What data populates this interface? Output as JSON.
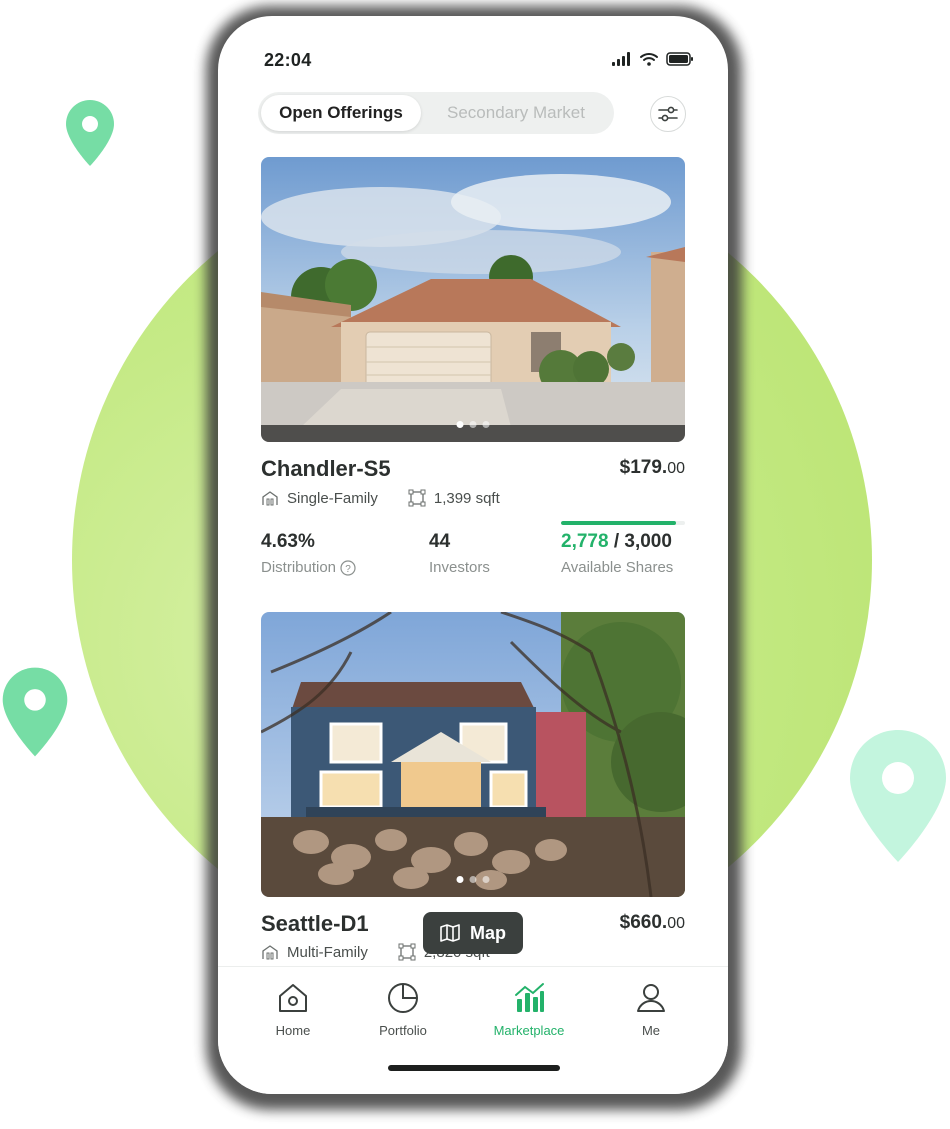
{
  "status_bar": {
    "time": "22:04"
  },
  "segmented": {
    "active": "Open Offerings",
    "inactive": "Secondary Market"
  },
  "listings": [
    {
      "name": "Chandler-S5",
      "price_whole": "$179.",
      "price_cents": "00",
      "type": "Single-Family",
      "area": "1,399 sqft",
      "distribution": "4.63%",
      "distribution_label": "Distribution",
      "investors": "44",
      "investors_label": "Investors",
      "available": "2,778",
      "total": "/ 3,000",
      "available_label": "Available Shares",
      "available_fraction": 0.926
    },
    {
      "name": "Seattle-D1",
      "price_whole": "$660.",
      "price_cents": "00",
      "type": "Multi-Family",
      "area": "2,820 sqft"
    }
  ],
  "map_button": "Map",
  "tabbar": {
    "home": "Home",
    "portfolio": "Portfolio",
    "marketplace": "Marketplace",
    "me": "Me"
  },
  "colors": {
    "accent": "#23b26a",
    "circle": "#c5ea86",
    "pin": "#6fdca4",
    "pin_light": "#b9f3d6"
  }
}
